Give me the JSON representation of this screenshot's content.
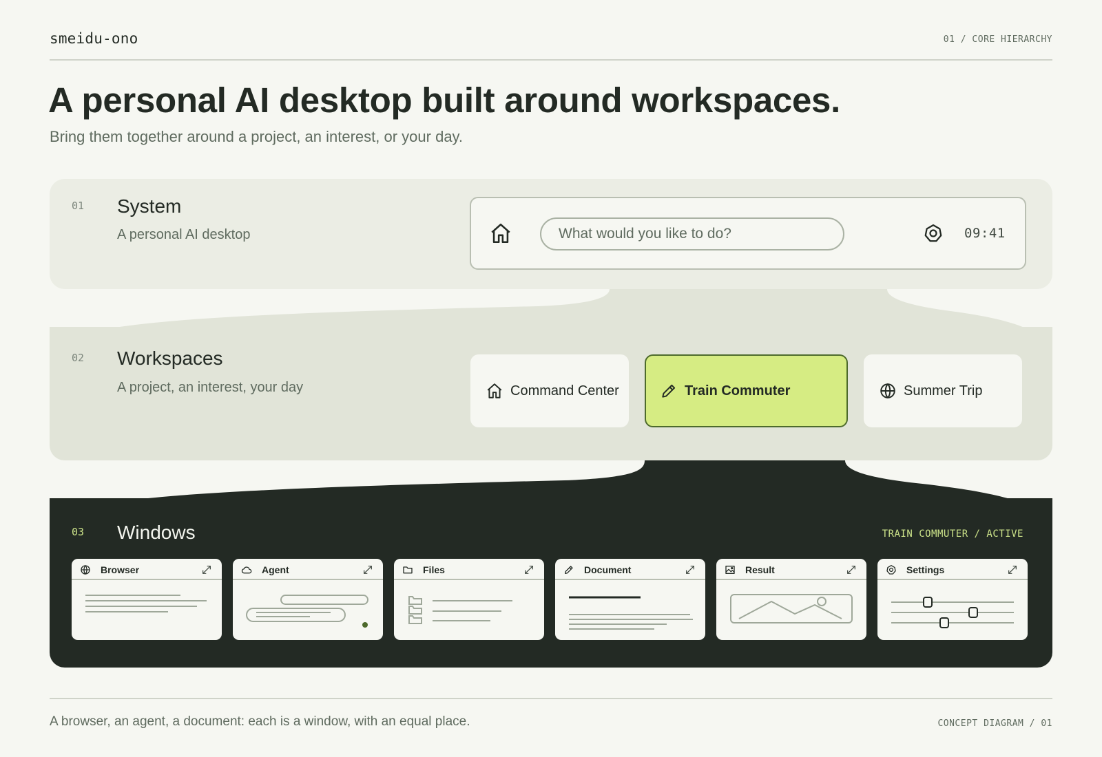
{
  "header": {
    "brand": "smeidu-ono",
    "crumb": "01 / CORE HIERARCHY"
  },
  "hero": {
    "title": "A personal AI desktop built around workspaces.",
    "subtitle": "Bring them together around a project, an interest, or your day."
  },
  "system": {
    "number": "01",
    "title": "System",
    "subtitle": "A personal AI desktop",
    "search_placeholder": "What would you like to do?",
    "clock": "09:41",
    "icons": [
      "home-icon",
      "settings-gear-icon"
    ]
  },
  "workspaces": {
    "number": "02",
    "title": "Workspaces",
    "subtitle": "A project, an interest, your day",
    "items": [
      {
        "label": "Command Center",
        "icon": "home-icon",
        "active": false
      },
      {
        "label": "Train Commuter",
        "icon": "pencil-icon",
        "active": true
      },
      {
        "label": "Summer Trip",
        "icon": "globe-icon",
        "active": false
      }
    ]
  },
  "windows": {
    "number": "03",
    "title": "Windows",
    "status": "TRAIN COMMUTER / ACTIVE",
    "items": [
      {
        "label": "Browser",
        "icon": "globe-icon"
      },
      {
        "label": "Agent",
        "icon": "cloud-icon"
      },
      {
        "label": "Files",
        "icon": "folder-icon"
      },
      {
        "label": "Document",
        "icon": "pencil-icon"
      },
      {
        "label": "Result",
        "icon": "image-icon"
      },
      {
        "label": "Settings",
        "icon": "settings-gear-icon"
      }
    ]
  },
  "footer": {
    "caption": "A browser, an agent, a document: each is a window, with an equal place.",
    "tag": "CONCEPT DIAGRAM / 01"
  },
  "colors": {
    "background": "#f6f7f2",
    "band_light": "#ebede4",
    "band_mid": "#e1e4d8",
    "band_dark": "#232a24",
    "accent": "#d6ec83",
    "accent_text": "#cde48a",
    "active_border": "#4d6a2c"
  }
}
